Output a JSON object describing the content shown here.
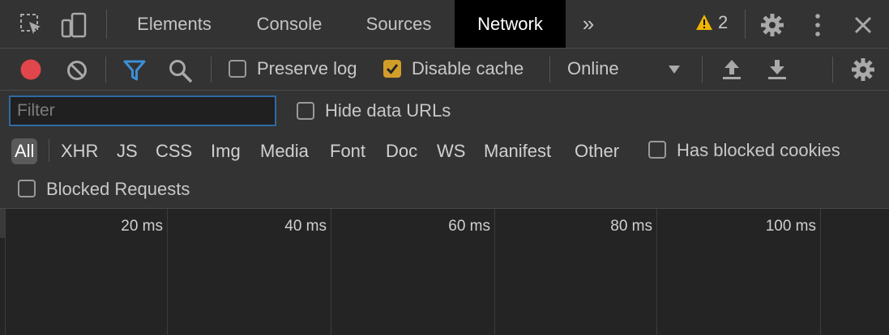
{
  "tabs": {
    "elements": "Elements",
    "console": "Console",
    "sources": "Sources",
    "network": "Network",
    "more": "»",
    "warning_count": "2"
  },
  "toolbar": {
    "preserve_log": "Preserve log",
    "disable_cache": "Disable cache",
    "disable_cache_checked": true,
    "preserve_log_checked": false,
    "throttling": "Online"
  },
  "filter": {
    "placeholder": "Filter",
    "hide_data_urls": "Hide data URLs",
    "types": [
      "All",
      "XHR",
      "JS",
      "CSS",
      "Img",
      "Media",
      "Font",
      "Doc",
      "WS",
      "Manifest",
      "Other"
    ],
    "active_type": "All",
    "has_blocked_cookies": "Has blocked cookies",
    "blocked_requests": "Blocked Requests"
  },
  "timeline": {
    "ticks": [
      "20 ms",
      "40 ms",
      "60 ms",
      "80 ms",
      "100 ms"
    ]
  },
  "colors": {
    "record": "#e0464b",
    "filter_icon": "#3d8fd6",
    "warning": "#f0b400",
    "checked": "#d39d2a",
    "active_tab_bg": "#000000"
  },
  "icons": [
    "inspect-element-icon",
    "device-toolbar-icon",
    "warning-icon",
    "settings-icon",
    "kebab-menu-icon",
    "close-icon",
    "record-icon",
    "clear-icon",
    "filter-icon",
    "search-icon",
    "dropdown-arrow-icon",
    "upload-icon",
    "download-icon"
  ]
}
